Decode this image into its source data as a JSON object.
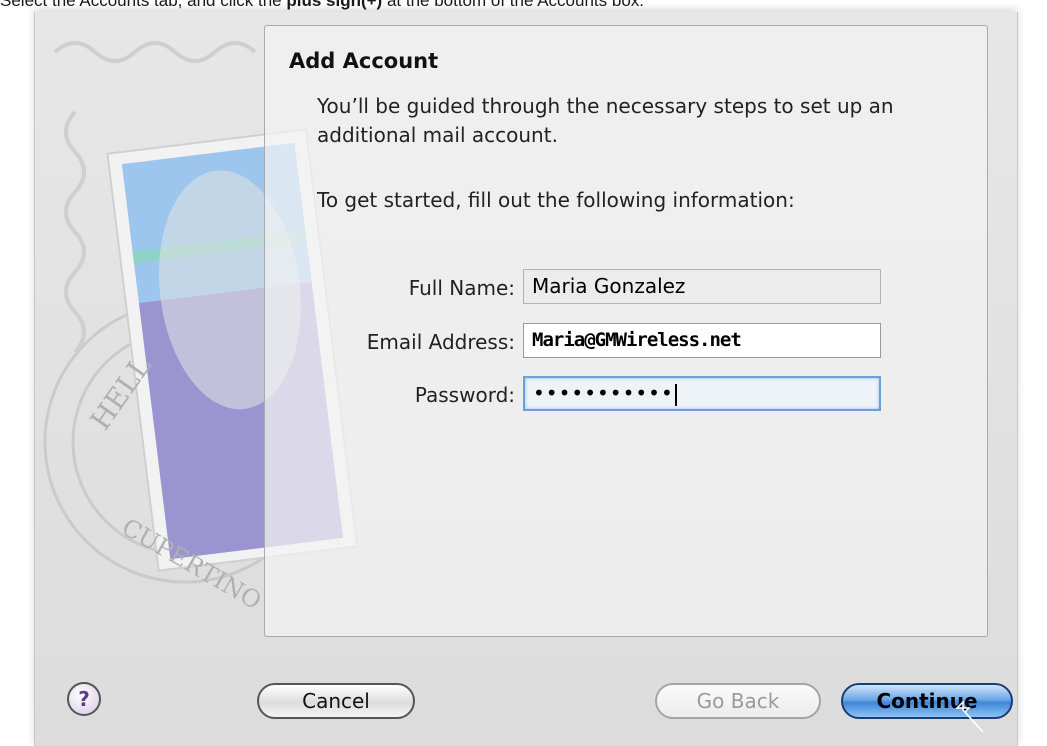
{
  "instruction": {
    "prefix": "Select the Accounts tab, and click the ",
    "bold": "plus sign(+)",
    "suffix": " at the bottom of the Accounts box."
  },
  "dialog": {
    "title": "Add Account",
    "description": "You’ll be guided through the necessary steps to set up an additional mail account.",
    "prompt": "To get started, fill out the following information:",
    "full_name": {
      "label": "Full Name:",
      "value": "Maria Gonzalez"
    },
    "email": {
      "label": "Email Address:",
      "value": "Maria@GMWireless.net"
    },
    "password": {
      "label": "Password:",
      "value": "•••••••••••"
    }
  },
  "art": {
    "stamp_text_top": "HELL",
    "stamp_text_bottom": "CUPERTINO"
  },
  "buttons": {
    "help": "?",
    "cancel": "Cancel",
    "go_back": "Go Back",
    "continue": "Continue"
  },
  "colors": {
    "accent": "#3f86d9",
    "stamp_sky": "#9cc6ee",
    "stamp_lavender": "#9a95d0"
  },
  "icons": [
    "help-icon",
    "stamp-icon",
    "cursor-arrow-icon"
  ]
}
